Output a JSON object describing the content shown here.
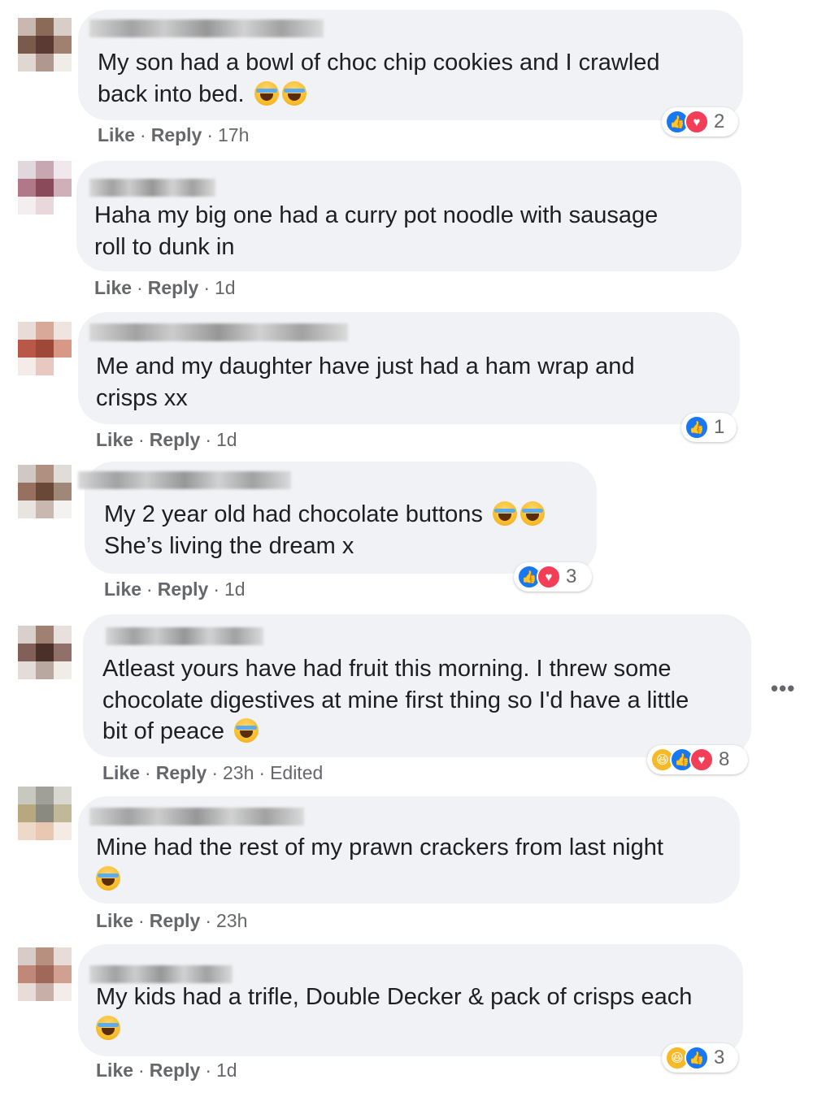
{
  "comments": [
    {
      "lines": [
        "My son had a bowl of choc chip cookies and I crawled",
        "back into bed."
      ],
      "emojis_last_line": 2,
      "actions": {
        "like": "Like",
        "reply": "Reply",
        "time": "17h",
        "edited": ""
      },
      "reactions": {
        "icons": [
          "like-icon",
          "love-icon"
        ],
        "count": "2"
      },
      "avatar_colors": [
        "#c8b8b0",
        "#8b6a58",
        "#d8cec8",
        "#7a5a4a",
        "#5a3a32",
        "#a08070",
        "#e0d8d0",
        "#b09890",
        "#f0ece8"
      ]
    },
    {
      "lines": [
        "Haha my big one had a curry pot noodle with sausage",
        "roll to dunk in"
      ],
      "emojis_last_line": 0,
      "actions": {
        "like": "Like",
        "reply": "Reply",
        "time": "1d",
        "edited": ""
      },
      "reactions": null,
      "avatar_colors": [
        "#e0d8dc",
        "#c8a8b0",
        "#f0e8ec",
        "#b07888",
        "#8a4a5a",
        "#d0b0b8",
        "#f4eef0",
        "#e8d8dc",
        "#ffffff"
      ]
    },
    {
      "lines": [
        "Me and my daughter have just had a ham wrap and",
        "crisps xx"
      ],
      "emojis_last_line": 0,
      "actions": {
        "like": "Like",
        "reply": "Reply",
        "time": "1d",
        "edited": ""
      },
      "reactions": {
        "icons": [
          "like-icon"
        ],
        "count": "1"
      },
      "avatar_colors": [
        "#e8dcd8",
        "#d8a898",
        "#f0e4e0",
        "#b85848",
        "#a04838",
        "#d89888",
        "#f4ece8",
        "#e8c8c0",
        "#ffffff"
      ]
    },
    {
      "lines": [
        "My 2 year old had chocolate buttons",
        "She’s living the dream x"
      ],
      "emojis_first_line": 2,
      "emojis_last_line": 0,
      "actions": {
        "like": "Like",
        "reply": "Reply",
        "time": "1d",
        "edited": ""
      },
      "reactions": {
        "icons": [
          "like-icon",
          "love-icon"
        ],
        "count": "3"
      },
      "avatar_colors": [
        "#d0c8c4",
        "#b09080",
        "#e0dcd8",
        "#987060",
        "#6a4838",
        "#a08878",
        "#e8e4e0",
        "#c8b8b0",
        "#f4f2f0"
      ]
    },
    {
      "lines": [
        "Atleast yours have had fruit this morning. I threw some",
        "chocolate digestives at mine first thing so I'd have a little",
        "bit of peace"
      ],
      "emojis_last_line": 1,
      "actions": {
        "like": "Like",
        "reply": "Reply",
        "time": "23h",
        "edited": "Edited"
      },
      "reactions": {
        "icons": [
          "haha-icon",
          "like-icon",
          "love-icon"
        ],
        "count": "8"
      },
      "avatar_colors": [
        "#d8d0cc",
        "#a08070",
        "#e8e0dc",
        "#806058",
        "#4a3028",
        "#907068",
        "#e4dcd8",
        "#b8a8a0",
        "#f0ece8"
      ]
    },
    {
      "lines": [
        "Mine had the rest of my prawn crackers from last night",
        ""
      ],
      "emojis_last_line": 1,
      "actions": {
        "like": "Like",
        "reply": "Reply",
        "time": "23h",
        "edited": ""
      },
      "reactions": null,
      "avatar_colors": [
        "#c8c8c0",
        "#a0a098",
        "#d8d8d0",
        "#b8a880",
        "#8a8a80",
        "#c0b898",
        "#f0d8c8",
        "#e8c8b0",
        "#f4ece4"
      ]
    },
    {
      "lines": [
        "My kids had a trifle, Double Decker & pack of crisps each",
        ""
      ],
      "emojis_last_line": 1,
      "actions": {
        "like": "Like",
        "reply": "Reply",
        "time": "1d",
        "edited": ""
      },
      "reactions": {
        "icons": [
          "haha-icon",
          "like-icon"
        ],
        "count": "3"
      },
      "avatar_colors": [
        "#d8ccc8",
        "#b89080",
        "#e8dcd8",
        "#c08878",
        "#a06858",
        "#d0a090",
        "#e8dcd8",
        "#c8b0a8",
        "#f4ece8"
      ]
    }
  ],
  "more_menu": "•••"
}
